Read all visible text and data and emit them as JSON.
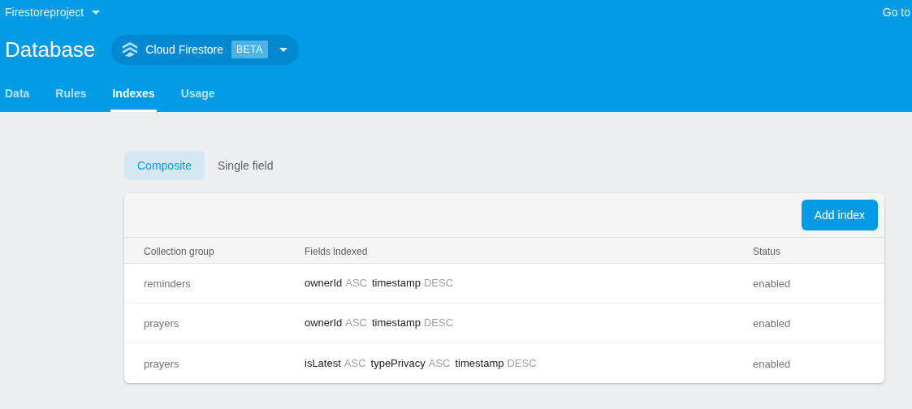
{
  "project": {
    "name": "Firestoreproject"
  },
  "top_link": "Go to",
  "title": "Database",
  "product": {
    "name": "Cloud Firestore",
    "badge": "BETA"
  },
  "tabs": [
    {
      "label": "Data",
      "selected": false
    },
    {
      "label": "Rules",
      "selected": false
    },
    {
      "label": "Indexes",
      "selected": true
    },
    {
      "label": "Usage",
      "selected": false
    }
  ],
  "index_types": [
    {
      "label": "Composite",
      "selected": true
    },
    {
      "label": "Single field",
      "selected": false
    }
  ],
  "add_button": "Add index",
  "table": {
    "columns": [
      "Collection group",
      "Fields indexed",
      "Status"
    ],
    "rows": [
      {
        "collection": "reminders",
        "fields": [
          {
            "name": "ownerId",
            "order": "ASC"
          },
          {
            "name": "timestamp",
            "order": "DESC"
          }
        ],
        "status": "enabled"
      },
      {
        "collection": "prayers",
        "fields": [
          {
            "name": "ownerId",
            "order": "ASC"
          },
          {
            "name": "timestamp",
            "order": "DESC"
          }
        ],
        "status": "enabled"
      },
      {
        "collection": "prayers",
        "fields": [
          {
            "name": "isLatest",
            "order": "ASC"
          },
          {
            "name": "typePrivacy",
            "order": "ASC"
          },
          {
            "name": "timestamp",
            "order": "DESC"
          }
        ],
        "status": "enabled"
      }
    ]
  }
}
